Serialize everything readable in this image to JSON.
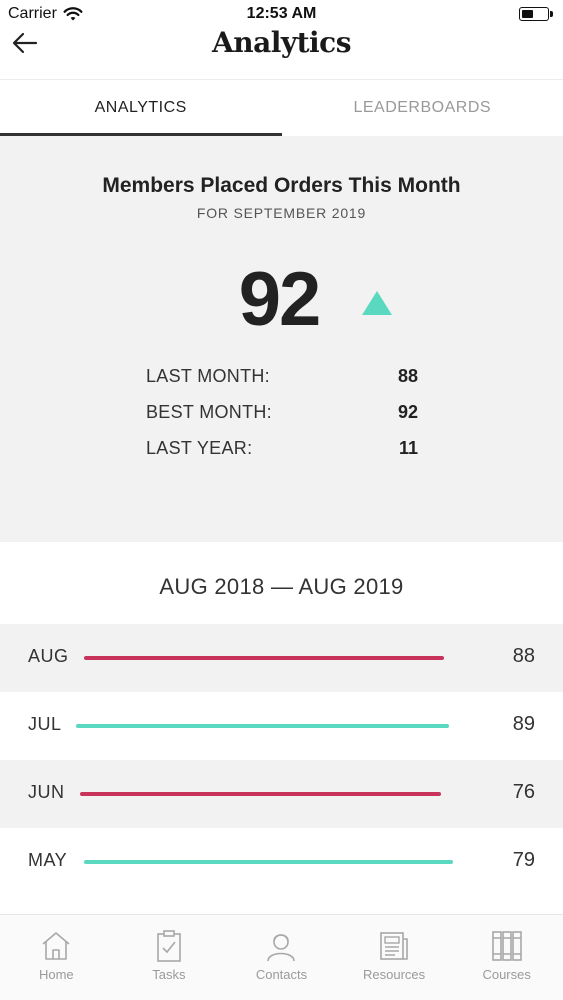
{
  "status_bar": {
    "carrier": "Carrier",
    "time": "12:53 AM",
    "battery_level": 0.45
  },
  "header": {
    "title": "Analytics",
    "back_icon": "arrow-left-icon"
  },
  "tabs": [
    {
      "label": "ANALYTICS",
      "active": true
    },
    {
      "label": "LEADERBOARDS",
      "active": false
    }
  ],
  "summary": {
    "title": "Members Placed Orders This Month",
    "subtitle": "FOR SEPTEMBER 2019",
    "value": "92",
    "trend_icon": "triangle-up-icon",
    "trend_color": "#5ad8c0",
    "stats": [
      {
        "label": "LAST MONTH:",
        "value": "88"
      },
      {
        "label": "BEST MONTH:",
        "value": "92"
      },
      {
        "label": "LAST YEAR:",
        "value": "11"
      }
    ]
  },
  "range_label": "AUG 2018 — AUG 2019",
  "colors": {
    "decrease": "#c8335c",
    "increase": "#5ad8c0"
  },
  "months": [
    {
      "label": "AUG",
      "value": "88",
      "trend": "down"
    },
    {
      "label": "JUL",
      "value": "89",
      "trend": "up"
    },
    {
      "label": "JUN",
      "value": "76",
      "trend": "down"
    },
    {
      "label": "MAY",
      "value": "79",
      "trend": "up"
    }
  ],
  "bottom_nav": [
    {
      "label": "Home",
      "icon": "home-icon"
    },
    {
      "label": "Tasks",
      "icon": "clipboard-check-icon"
    },
    {
      "label": "Contacts",
      "icon": "person-icon"
    },
    {
      "label": "Resources",
      "icon": "newspaper-icon"
    },
    {
      "label": "Courses",
      "icon": "books-icon"
    }
  ]
}
